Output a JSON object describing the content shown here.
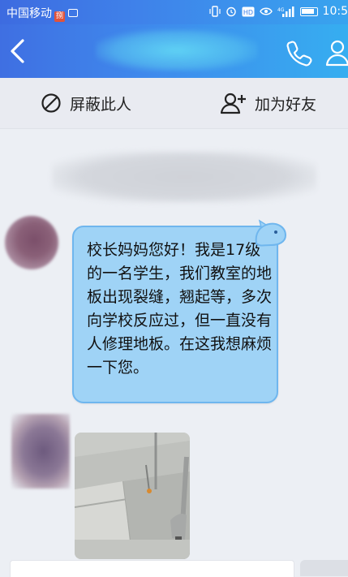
{
  "status_bar": {
    "carrier": "中国移动",
    "carrier_badge": "捌",
    "time": "10:5",
    "icons": [
      "vibrate-icon",
      "alarm-icon",
      "hd-icon",
      "eye-icon",
      "signal-icon",
      "battery-icon"
    ]
  },
  "header": {
    "title": "",
    "subtitle": "",
    "icons": [
      "back-icon",
      "phone-icon",
      "profile-icon"
    ]
  },
  "actions": {
    "block_label": "屏蔽此人",
    "add_friend_label": "加为好友",
    "icons": [
      "block-icon",
      "add-friend-icon"
    ]
  },
  "messages": [
    {
      "type": "text",
      "text": "校长妈妈您好！我是17级的一名学生，我们教室的地板出现裂缝，翘起等，多次向学校反应过，但一直没有人修理地板。在这我想麻烦一下您。"
    },
    {
      "type": "image",
      "alt": ""
    }
  ],
  "colors": {
    "header_start": "#3f6fe2",
    "header_end": "#36aef0",
    "bubble_fill": "#9fd3f6",
    "bubble_border": "#6fb6ee",
    "background": "#eceff4"
  }
}
